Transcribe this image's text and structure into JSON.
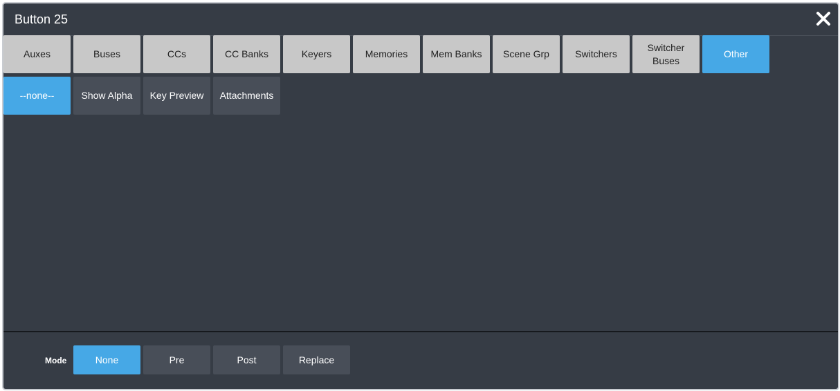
{
  "dialog": {
    "title": "Button 25",
    "close_icon": "close-icon"
  },
  "categories": {
    "items": [
      {
        "label": "Auxes",
        "selected": false
      },
      {
        "label": "Buses",
        "selected": false
      },
      {
        "label": "CCs",
        "selected": false
      },
      {
        "label": "CC Banks",
        "selected": false
      },
      {
        "label": "Keyers",
        "selected": false
      },
      {
        "label": "Memories",
        "selected": false
      },
      {
        "label": "Mem Banks",
        "selected": false
      },
      {
        "label": "Scene Grp",
        "selected": false
      },
      {
        "label": "Switchers",
        "selected": false
      },
      {
        "label": "Switcher Buses",
        "selected": false
      },
      {
        "label": "Other",
        "selected": true
      }
    ]
  },
  "options": {
    "items": [
      {
        "label": "--none--",
        "selected": true
      },
      {
        "label": "Show Alpha",
        "selected": false
      },
      {
        "label": "Key Preview",
        "selected": false
      },
      {
        "label": "Attachments",
        "selected": false
      }
    ]
  },
  "mode": {
    "label": "Mode",
    "items": [
      {
        "label": "None",
        "selected": true
      },
      {
        "label": "Pre",
        "selected": false
      },
      {
        "label": "Post",
        "selected": false
      },
      {
        "label": "Replace",
        "selected": false
      }
    ]
  },
  "colors": {
    "background": "#363c45",
    "accent": "#46a8e6",
    "light_button": "#c8c8c8",
    "dark_button": "#484e58"
  }
}
